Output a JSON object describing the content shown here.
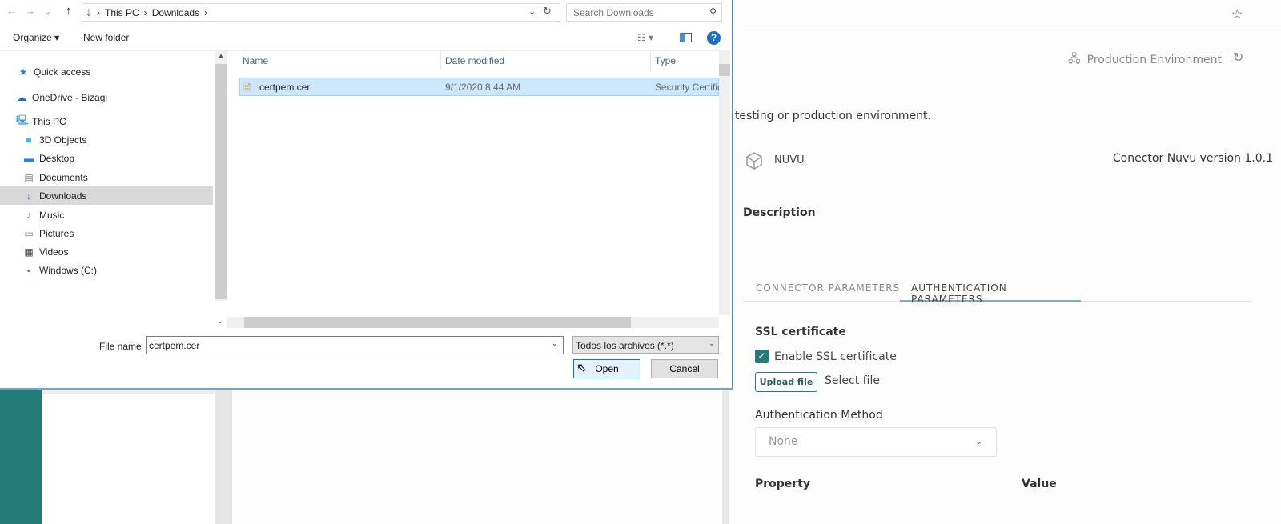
{
  "app": {
    "environment": "Production Environment",
    "description_fragment": "testing or production environment.",
    "connector_name": "NUVU",
    "connector_version": "Conector Nuvu version 1.0.1",
    "description_label": "Description",
    "tabs": [
      "CONNECTOR PARAMETERS",
      "AUTHENTICATION PARAMETERS"
    ],
    "active_tab": "AUTHENTICATION PARAMETERS",
    "ssl_heading": "SSL certificate",
    "enable_ssl_label": "Enable SSL certificate",
    "enable_ssl_checked": true,
    "upload_button": "Upload file",
    "select_file": "Select file",
    "auth_method_label": "Authentication Method",
    "auth_method_value": "None",
    "table_headers": [
      "Property",
      "Value"
    ],
    "accent_color": "#237b78"
  },
  "dialog": {
    "breadcrumb": [
      "This PC",
      "Downloads"
    ],
    "search_placeholder": "Search Downloads",
    "toolbar": {
      "organize": "Organize ▾",
      "new_folder": "New folder"
    },
    "nav": [
      {
        "label": "Quick access",
        "icon": "star-icon"
      },
      {
        "label": "OneDrive - Bizagi",
        "icon": "cloud-icon"
      },
      {
        "label": "This PC",
        "icon": "computer-icon"
      },
      {
        "label": "3D Objects",
        "icon": "cube-icon"
      },
      {
        "label": "Desktop",
        "icon": "desktop-icon"
      },
      {
        "label": "Documents",
        "icon": "document-icon"
      },
      {
        "label": "Downloads",
        "icon": "download-icon",
        "selected": true
      },
      {
        "label": "Music",
        "icon": "music-icon"
      },
      {
        "label": "Pictures",
        "icon": "picture-icon"
      },
      {
        "label": "Videos",
        "icon": "video-icon"
      },
      {
        "label": "Windows (C:)",
        "icon": "drive-icon"
      }
    ],
    "columns": [
      "Name",
      "Date modified",
      "Type"
    ],
    "files": [
      {
        "name": "certpem.cer",
        "date": "9/1/2020 8:44 AM",
        "type": "Security Certific"
      }
    ],
    "file_name_label": "File name:",
    "file_name_value": "certpem.cer",
    "file_type": "Todos los archivos (*.*)",
    "open": "Open",
    "cancel": "Cancel"
  }
}
